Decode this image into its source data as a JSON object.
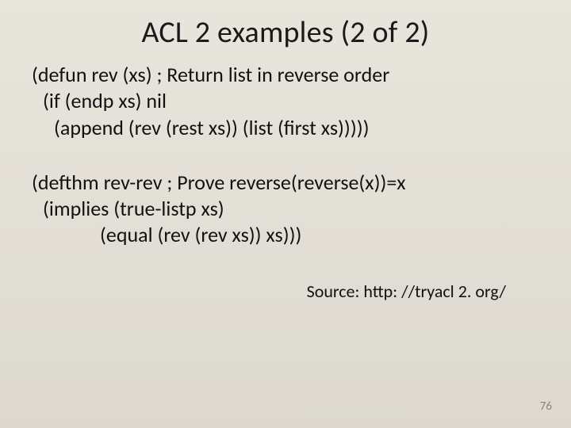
{
  "title": "ACL 2 examples (2 of 2)",
  "block1": {
    "l1": "(defun rev (xs)  ; Return list in reverse order",
    "l2": "(if (endp xs) nil",
    "l3": "(append (rev (rest xs)) (list (first xs)))))"
  },
  "block2": {
    "l1": "(defthm rev-rev ; Prove reverse(reverse(x))=x",
    "l2": "(implies (true-listp xs)",
    "l3": "(equal (rev (rev xs)) xs)))"
  },
  "source": "Source: http: //tryacl 2. org/",
  "pagenum": "76"
}
